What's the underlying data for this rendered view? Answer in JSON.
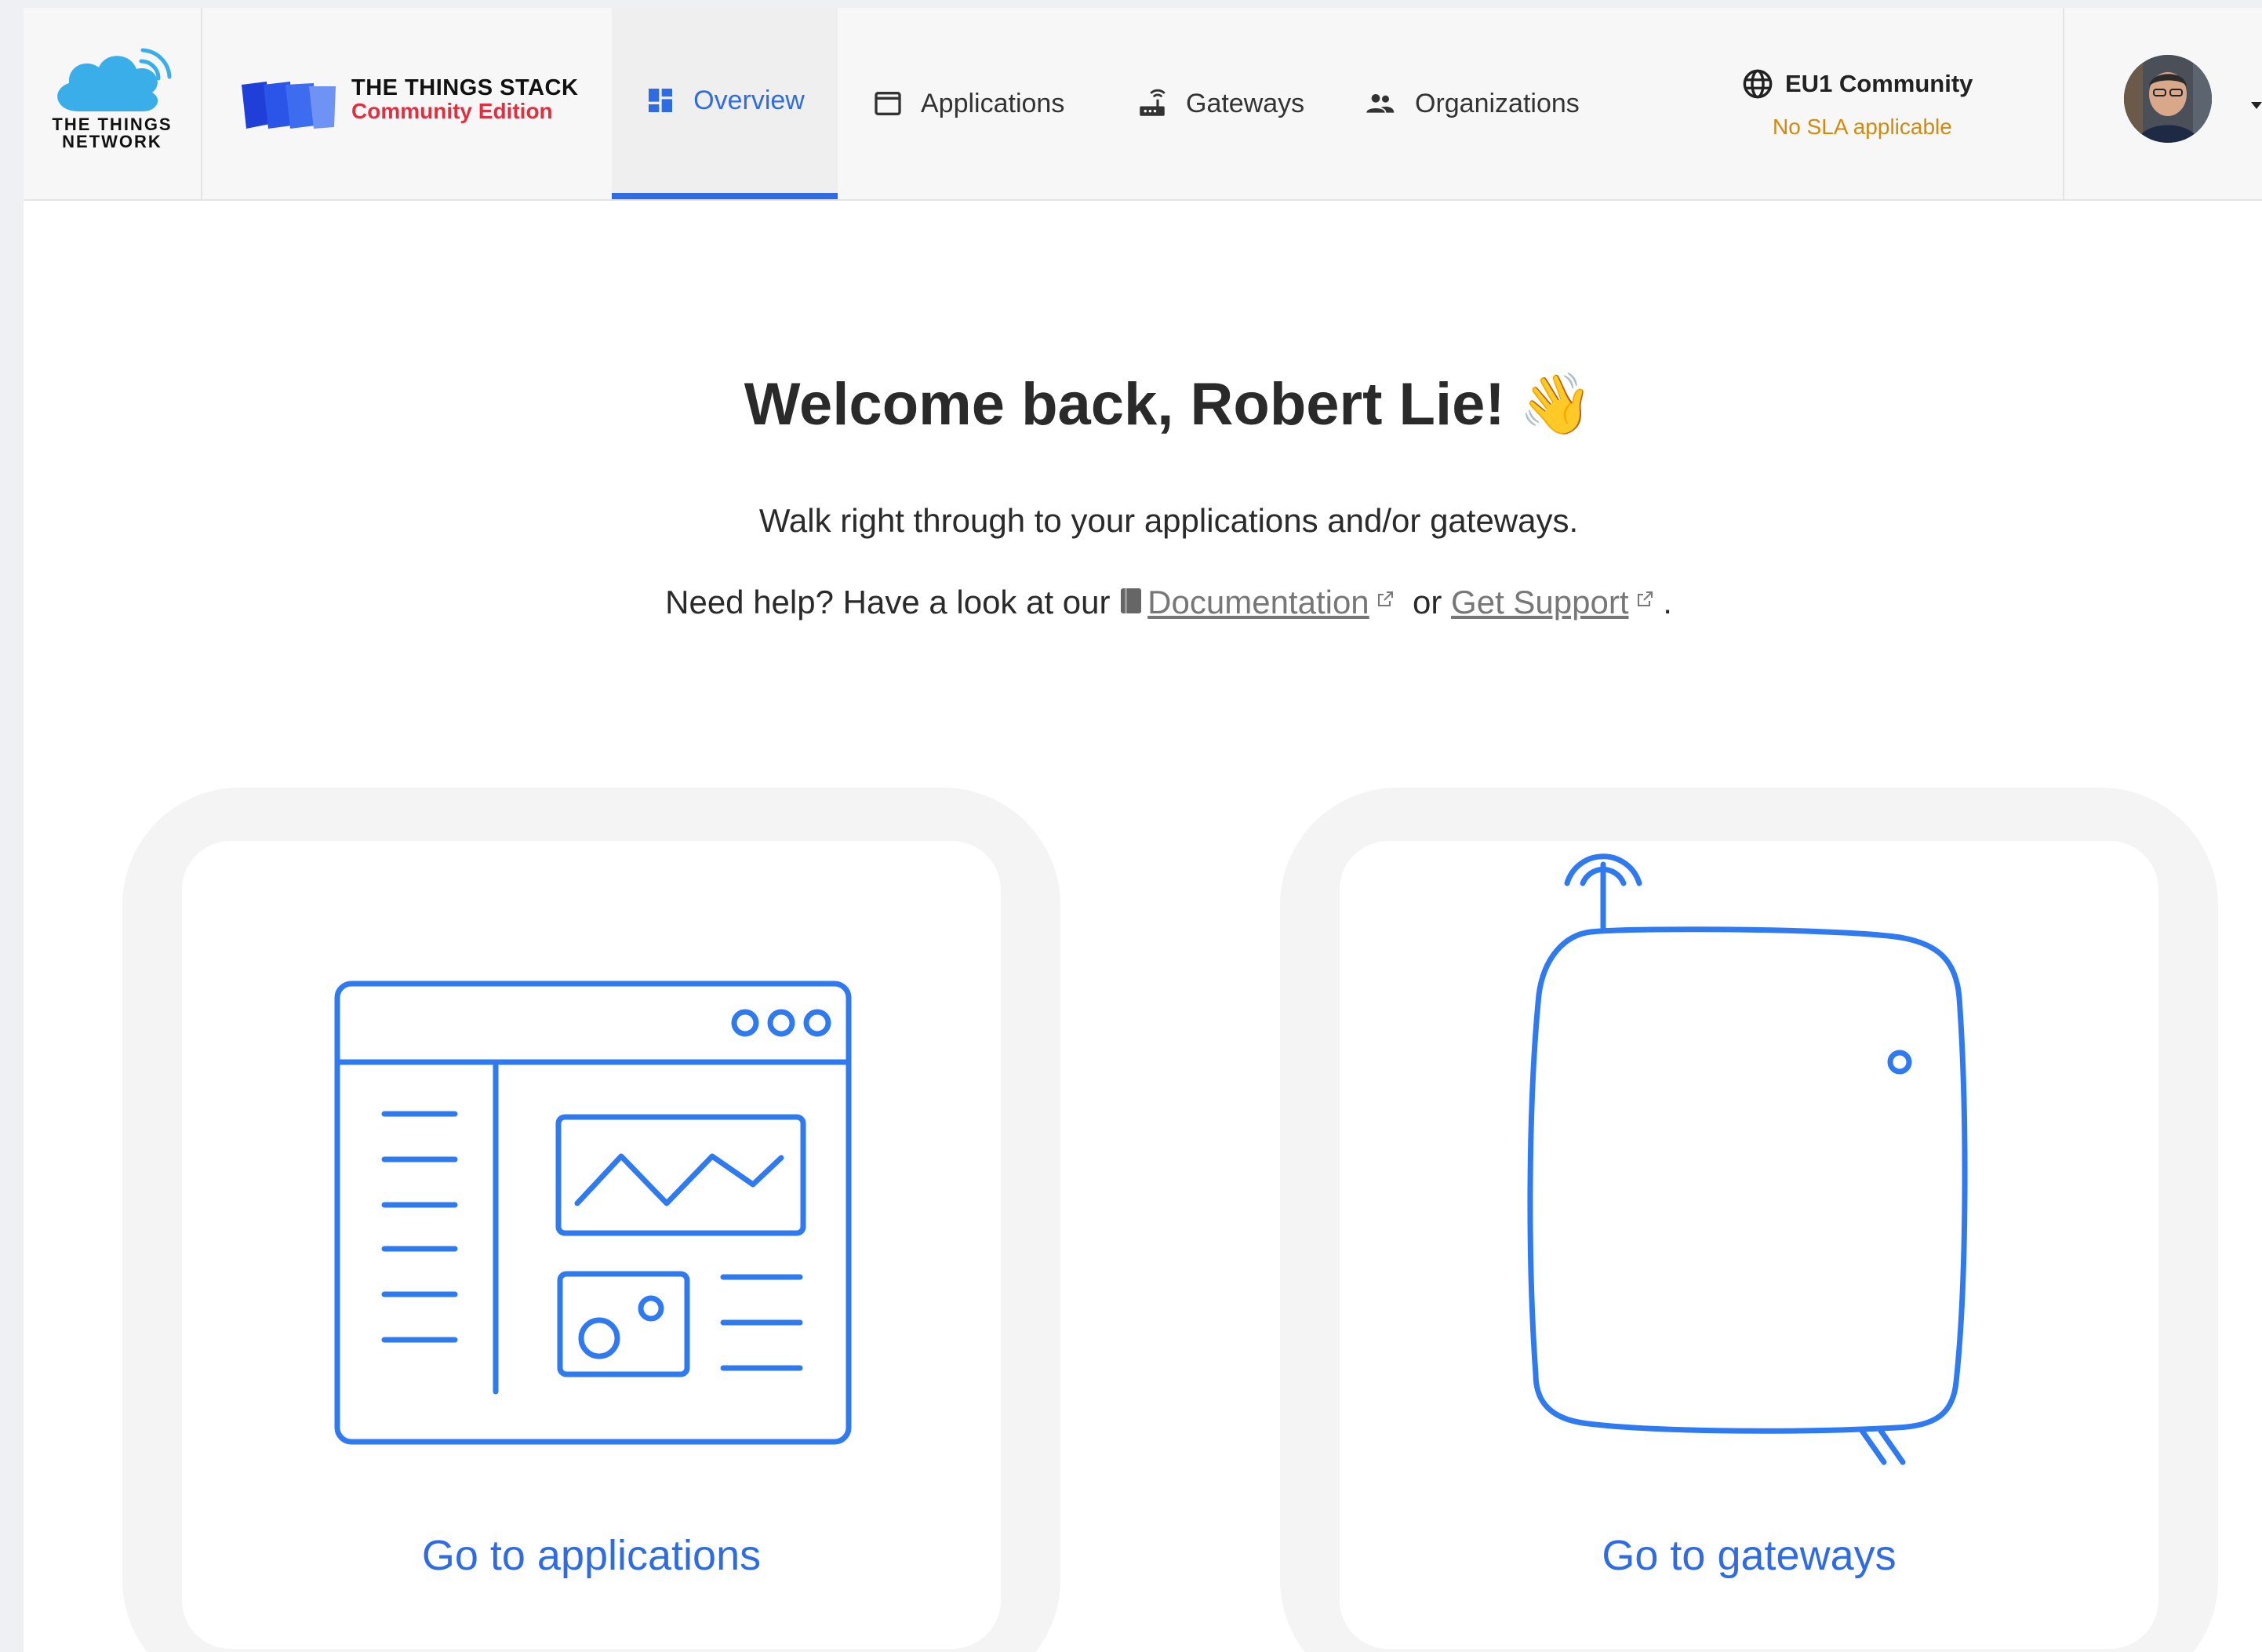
{
  "brand": {
    "ttn_text_line1": "THE THINGS",
    "ttn_text_line2": "NETWORK",
    "stack_title": "THE THINGS STACK",
    "stack_edition": "Community Edition"
  },
  "nav": {
    "items": [
      {
        "label": "Overview",
        "icon": "dashboard-icon",
        "active": true
      },
      {
        "label": "Applications",
        "icon": "window-icon",
        "active": false
      },
      {
        "label": "Gateways",
        "icon": "router-icon",
        "active": false
      },
      {
        "label": "Organizations",
        "icon": "people-icon",
        "active": false
      }
    ]
  },
  "cluster": {
    "name": "EU1 Community",
    "sla": "No SLA applicable",
    "icon": "globe-icon"
  },
  "user": {
    "avatar": "avatar"
  },
  "welcome": {
    "title": "Welcome back, Robert Lie!",
    "emoji": "👋",
    "subtitle": "Walk right through to your applications and/or gateways.",
    "help_prefix": "Need help? Have a look at our",
    "doc_link": "Documentation",
    "or_text": "or",
    "support_link": "Get Support",
    "period": "."
  },
  "cards": {
    "applications_label": "Go to applications",
    "gateways_label": "Go to gateways"
  },
  "colors": {
    "accent": "#2f6be3",
    "sla": "#d08a0c",
    "brand_red": "#e0303f"
  }
}
